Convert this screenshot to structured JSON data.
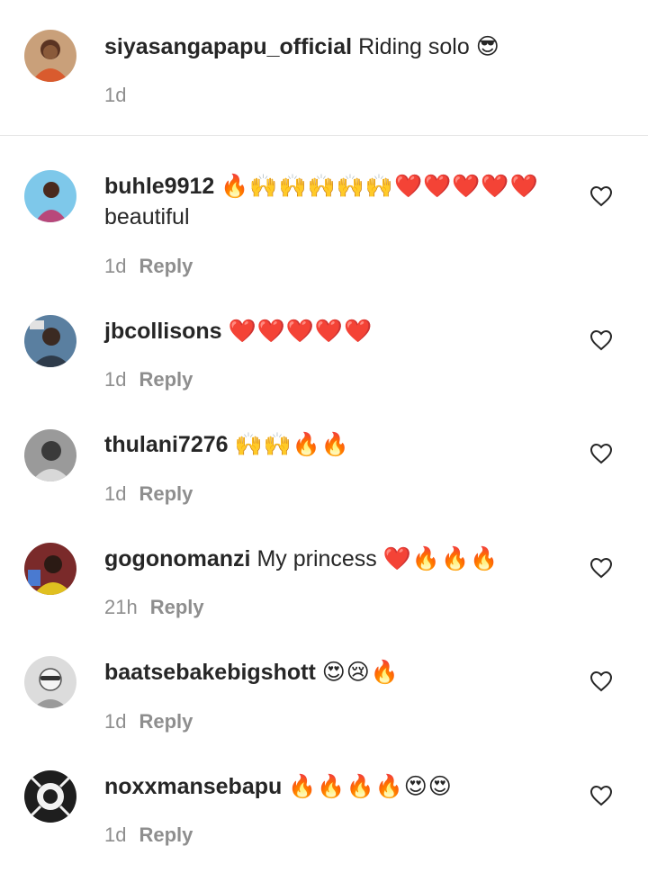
{
  "caption": {
    "username": "siyasangapapu_official",
    "text": "Riding solo",
    "emoji": "😎",
    "time": "1d"
  },
  "reply_label": "Reply",
  "comments": [
    {
      "username": "buhle9912",
      "emoji": "🔥🙌🙌🙌🙌🙌❤️❤️❤️❤️❤️",
      "text": "beautiful",
      "time": "1d"
    },
    {
      "username": "jbcollisons",
      "emoji": "❤️❤️❤️❤️❤️",
      "text": "",
      "time": "1d"
    },
    {
      "username": "thulani7276",
      "emoji": "🙌🙌🔥🔥",
      "text": "",
      "time": "1d"
    },
    {
      "username": "gogonomanzi",
      "text": "My princess",
      "emoji": "❤️🔥🔥🔥",
      "time": "21h"
    },
    {
      "username": "baatsebakebigshott",
      "emoji": "😍😢🔥",
      "text": "",
      "time": "1d"
    },
    {
      "username": "noxxmansebapu",
      "emoji": "🔥🔥🔥🔥😍😍",
      "text": "",
      "time": "1d"
    }
  ],
  "colors": {
    "text": "#262626",
    "meta": "#8e8e8e",
    "divider": "#e6e6e6"
  },
  "icons": {
    "like": "heart-outline-icon"
  }
}
